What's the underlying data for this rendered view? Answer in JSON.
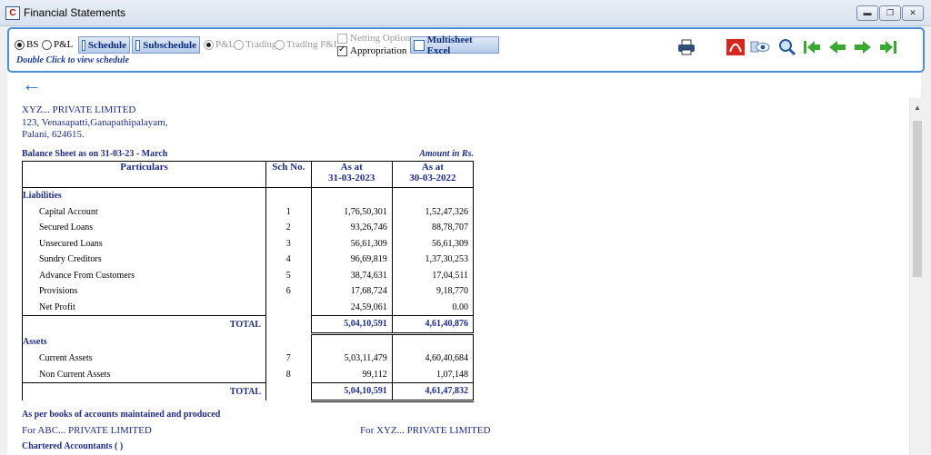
{
  "window": {
    "title": "Financial Statements",
    "min": "▬",
    "max": "❐",
    "close": "✕"
  },
  "toolbar": {
    "bs": "BS",
    "pl": "P&L",
    "schedule": "Schedule",
    "subschedule": "Subschedule",
    "pl2": "P&L",
    "trading": "Trading",
    "trading_pl": "Trading P&L",
    "netting": "Netting Option",
    "appropriation": "Appropriation",
    "multisheet": "Multisheet Excel",
    "hint": "Double Click to view schedule"
  },
  "back_arrow": "←",
  "company": {
    "name": "XYZ... PRIVATE LIMITED",
    "address_line1": "123, Venasapatti,Ganapathipalayam,",
    "address_line2": "Palani, 624615."
  },
  "report": {
    "title": "Balance Sheet as on 31-03-23 - March",
    "amount_note": "Amount in Rs."
  },
  "table": {
    "headers": {
      "particulars": "Particulars",
      "sch": "Sch No.",
      "col1_a": "As at",
      "col1_b": "31-03-2023",
      "col2_a": "As at",
      "col2_b": "30-03-2022"
    },
    "liabilities_label": "Liabilities",
    "liabilities": [
      {
        "name": "Capital Account",
        "sch": "1",
        "cy": "1,76,50,301",
        "py": "1,52,47,326"
      },
      {
        "name": "Secured Loans",
        "sch": "2",
        "cy": "93,26,746",
        "py": "88,78,707"
      },
      {
        "name": "Unsecured Loans",
        "sch": "3",
        "cy": "56,61,309",
        "py": "56,61,309"
      },
      {
        "name": "Sundry Creditors",
        "sch": "4",
        "cy": "96,69,819",
        "py": "1,37,30,253"
      },
      {
        "name": "Advance From Customers",
        "sch": "5",
        "cy": "38,74,631",
        "py": "17,04,511"
      },
      {
        "name": "Provisions",
        "sch": "6",
        "cy": "17,68,724",
        "py": "9,18,770"
      },
      {
        "name": "Net Profit",
        "sch": "",
        "cy": "24,59,061",
        "py": "0.00"
      }
    ],
    "liab_total": {
      "label": "TOTAL",
      "cy": "5,04,10,591",
      "py": "4,61,40,876"
    },
    "assets_label": "Assets",
    "assets": [
      {
        "name": "Current Assets",
        "sch": "7",
        "cy": "5,03,11,479",
        "py": "4,60,40,684"
      },
      {
        "name": "Non Current Assets",
        "sch": "8",
        "cy": "99,112",
        "py": "1,07,148"
      }
    ],
    "assets_total": {
      "label": "TOTAL",
      "cy": "5,04,10,591",
      "py": "4,61,47,832"
    }
  },
  "footer": {
    "books": "As per books of accounts maintained and produced",
    "for_left": "For  ABC... PRIVATE LIMITED",
    "for_right": "For XYZ... PRIVATE LIMITED",
    "ca": "Chartered Accountants ( )"
  },
  "colors": {
    "accent": "#4a90d9",
    "text_blue": "#1f2d8a",
    "green_arrow": "#3aa832",
    "pdf_red": "#d9261c"
  }
}
